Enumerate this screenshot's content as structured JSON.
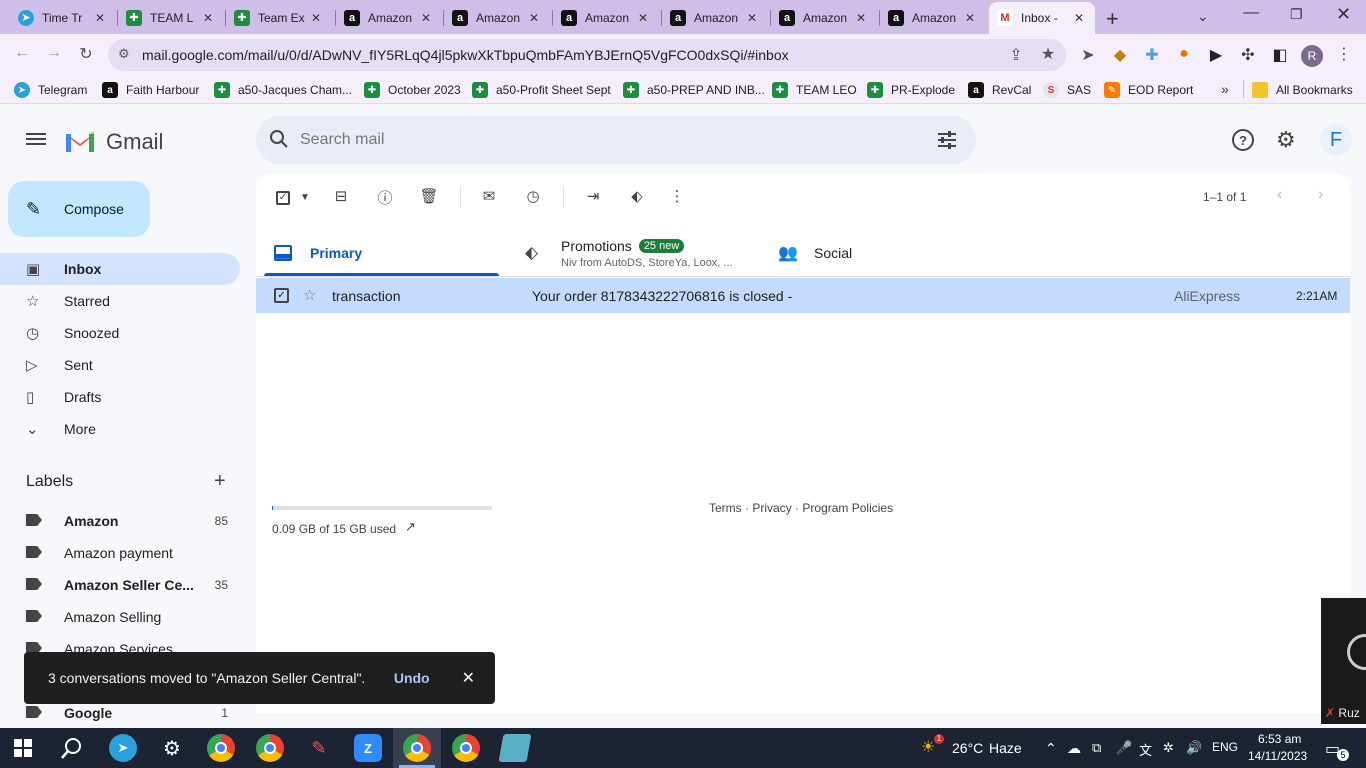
{
  "browser": {
    "tabs": [
      {
        "title": "Time Tr",
        "icon": "telegram-icon"
      },
      {
        "title": "TEAM L",
        "icon": "sheets-icon"
      },
      {
        "title": "Team Ex",
        "icon": "sheets-icon"
      },
      {
        "title": "Amazon",
        "icon": "amazon-icon"
      },
      {
        "title": "Amazon",
        "icon": "amazon-icon"
      },
      {
        "title": "Amazon",
        "icon": "amazon-icon"
      },
      {
        "title": "Amazon",
        "icon": "amazon-icon"
      },
      {
        "title": "Amazon",
        "icon": "amazon-icon"
      },
      {
        "title": "Amazon",
        "icon": "amazon-icon"
      },
      {
        "title": "Inbox -",
        "icon": "gmail-icon",
        "active": true
      }
    ],
    "url": "mail.google.com/mail/u/0/d/ADwNV_fIY5RLqQ4jl5pkwXkTbpuQmbFAmYBJErnQ5VgFCO0dxSQi/#inbox",
    "profile_initial": "R",
    "bookmarks": [
      {
        "label": "Telegram",
        "icon": "telegram-icon"
      },
      {
        "label": "Faith Harbour",
        "icon": "amazon-icon"
      },
      {
        "label": "a50-Jacques Cham...",
        "icon": "sheets-icon"
      },
      {
        "label": "October 2023",
        "icon": "sheets-icon"
      },
      {
        "label": "a50-Profit Sheet Sept",
        "icon": "sheets-icon"
      },
      {
        "label": "a50-PREP AND INB...",
        "icon": "sheets-icon"
      },
      {
        "label": "TEAM LEO",
        "icon": "sheets-icon"
      },
      {
        "label": "PR-Explode",
        "icon": "sheets-icon"
      },
      {
        "label": "RevCal",
        "icon": "amazon-icon"
      },
      {
        "label": "SAS",
        "icon": "sas-icon"
      },
      {
        "label": "EOD Report",
        "icon": "eod-icon"
      }
    ],
    "more_bookmarks": "»",
    "all_bookmarks": "All Bookmarks"
  },
  "gmail": {
    "logo_text": "Gmail",
    "search_placeholder": "Search mail",
    "account_initial": "F",
    "compose_label": "Compose",
    "nav": [
      {
        "label": "Inbox",
        "icon": "inbox-icon",
        "selected": true
      },
      {
        "label": "Starred",
        "icon": "star-icon"
      },
      {
        "label": "Snoozed",
        "icon": "clock-icon"
      },
      {
        "label": "Sent",
        "icon": "send-icon"
      },
      {
        "label": "Drafts",
        "icon": "draft-icon"
      },
      {
        "label": "More",
        "icon": "chevron-down-icon"
      }
    ],
    "labels_heading": "Labels",
    "labels": [
      {
        "name": "Amazon",
        "count": "85",
        "bold": true
      },
      {
        "name": "Amazon payment",
        "count": "",
        "bold": false
      },
      {
        "name": "Amazon Seller Ce...",
        "count": "35",
        "bold": true
      },
      {
        "name": "Amazon Selling",
        "count": "",
        "bold": false
      },
      {
        "name": "Amazon Services",
        "count": "",
        "bold": false
      },
      {
        "name": "Google",
        "count": "1",
        "bold": true
      }
    ],
    "pagination": "1–1 of 1",
    "categories": {
      "primary": "Primary",
      "promotions": "Promotions",
      "promotions_badge": "25 new",
      "promotions_snippet": "Niv from AutoDS, StoreYa, Loox, ...",
      "social": "Social"
    },
    "email": {
      "sender": "transaction",
      "subject": "Your order 8178343222706816 is closed -",
      "label": "AliExpress",
      "time": "2:21AM"
    },
    "storage": "0.09 GB of 15 GB used",
    "storage_fraction": 0.006,
    "footer": {
      "terms": "Terms",
      "privacy": "Privacy",
      "policies": "Program Policies",
      "dot": "·"
    },
    "snackbar": {
      "message": "3 conversations moved to \"Amazon Seller Central\".",
      "undo": "Undo"
    },
    "video_caption": "Ruz"
  },
  "taskbar": {
    "weather_temp": "26°C",
    "weather_desc": "Haze",
    "language": "ENG",
    "time": "6:53 am",
    "date": "14/11/2023",
    "notification_count": "5",
    "weather_badge": "1"
  },
  "colors": {
    "accent": "#0b57d0",
    "selected": "#d3e3fd",
    "compose": "#c2e7ff",
    "badge": "#188038"
  }
}
